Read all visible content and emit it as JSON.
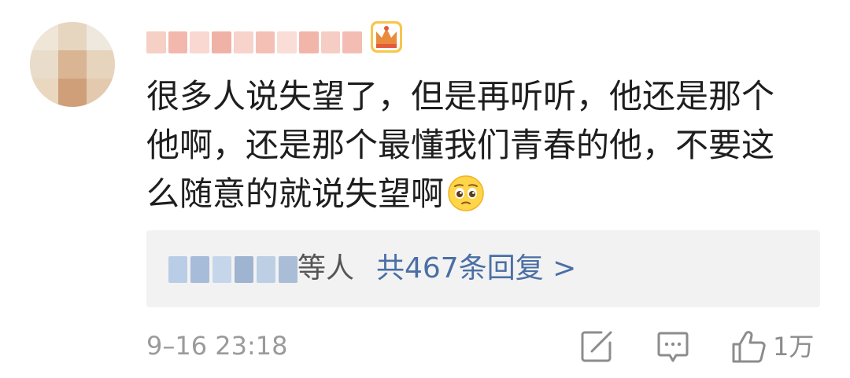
{
  "comment": {
    "text_lines": [
      "很多人说失望了，但是再听听，他还是那个",
      "他啊，还是那个最懂我们青春的他，不要这",
      "么随意的就说失望啊"
    ],
    "emoji": "pleading-face-emoji"
  },
  "user": {
    "badge_icon": "crown-icon",
    "badge_color": "#e8a630"
  },
  "replies": {
    "suffix": "等人",
    "count_label": "共467条回复 >",
    "link_color": "#4a6fa5"
  },
  "meta": {
    "timestamp": "9–16 23:18",
    "like_count": "1万"
  },
  "icons": {
    "share": "share-edit-icon",
    "comment": "comment-icon",
    "like": "thumbs-up-icon"
  }
}
